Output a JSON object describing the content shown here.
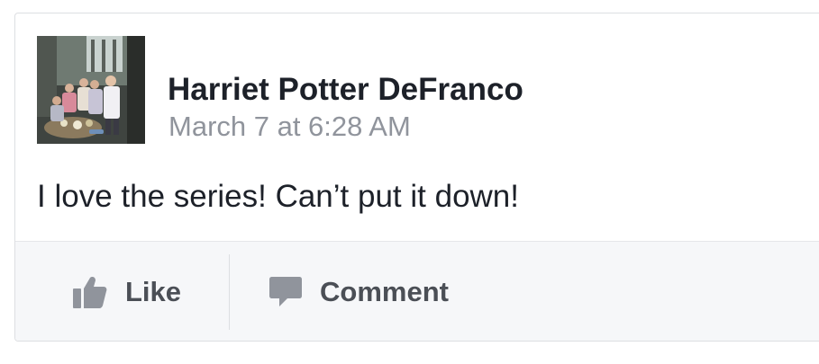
{
  "post": {
    "author": "Harriet Potter DeFranco",
    "timestamp": "March 7 at 6:28 AM",
    "text": "I love the series! Can’t put it down!"
  },
  "actions": {
    "like": {
      "label": "Like",
      "icon": "thumbs-up-icon"
    },
    "comment": {
      "label": "Comment",
      "icon": "speech-bubble-icon"
    }
  },
  "colors": {
    "author": "#1d2129",
    "timestamp": "#90949c",
    "action_text": "#4b4f56",
    "action_icon": "#90949c",
    "action_bar": "#f6f7f9",
    "border": "#dddfe2"
  }
}
